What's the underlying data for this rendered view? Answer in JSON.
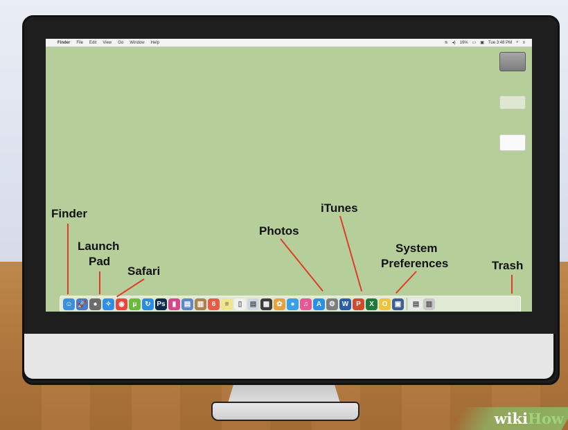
{
  "menubar": {
    "apple": "",
    "app": "Finder",
    "menus": [
      "File",
      "Edit",
      "View",
      "Go",
      "Window",
      "Help"
    ],
    "battery": "16%",
    "clock": "Tue 3:48 PM"
  },
  "callouts": {
    "finder": "Finder",
    "launchpad_line1": "Launch",
    "launchpad_line2": "Pad",
    "safari": "Safari",
    "photos": "Photos",
    "itunes": "iTunes",
    "sysprefs_line1": "System",
    "sysprefs_line2": "Preferences",
    "trash": "Trash"
  },
  "dock_icons": [
    {
      "name": "finder-icon",
      "color": "#3b8fe0",
      "glyph": "☺"
    },
    {
      "name": "launchpad-icon",
      "color": "#4a79c6",
      "glyph": "🚀"
    },
    {
      "name": "app-icon",
      "color": "#6c6c6c",
      "glyph": "●"
    },
    {
      "name": "safari-icon",
      "color": "#2f8fe8",
      "glyph": "✧"
    },
    {
      "name": "chrome-icon",
      "color": "#e9473b",
      "glyph": "◉"
    },
    {
      "name": "utorrent-icon",
      "color": "#6aba3b",
      "glyph": "μ"
    },
    {
      "name": "sync-icon",
      "color": "#2b8de0",
      "glyph": "↻"
    },
    {
      "name": "photoshop-icon",
      "color": "#0c2a4e",
      "glyph": "Ps"
    },
    {
      "name": "app-icon-pink",
      "color": "#d8458d",
      "glyph": "▮"
    },
    {
      "name": "preview-icon",
      "color": "#5e87c8",
      "glyph": "▤"
    },
    {
      "name": "contacts-icon",
      "color": "#a9824e",
      "glyph": "▥"
    },
    {
      "name": "calendar-icon",
      "color": "#ea5b46",
      "glyph": "6"
    },
    {
      "name": "notes-icon",
      "color": "#f1e58a",
      "glyph": "≡"
    },
    {
      "name": "textedit-icon",
      "color": "#f0f0f0",
      "glyph": "▯"
    },
    {
      "name": "document-icon",
      "color": "#cfd8e2",
      "glyph": "▤"
    },
    {
      "name": "app-icon-dark",
      "color": "#3d3d3d",
      "glyph": "▩"
    },
    {
      "name": "photos-icon",
      "color": "#e6a23c",
      "glyph": "✿"
    },
    {
      "name": "messages-icon",
      "color": "#36a0e8",
      "glyph": "●"
    },
    {
      "name": "itunes-icon",
      "color": "#e75795",
      "glyph": "♫"
    },
    {
      "name": "app-store-icon",
      "color": "#2a8fe6",
      "glyph": "A"
    },
    {
      "name": "system-preferences-icon",
      "color": "#7e7e7e",
      "glyph": "⚙"
    },
    {
      "name": "word-icon",
      "color": "#2b5ca8",
      "glyph": "W"
    },
    {
      "name": "powerpoint-icon",
      "color": "#d24a2c",
      "glyph": "P"
    },
    {
      "name": "excel-icon",
      "color": "#1d7a3c",
      "glyph": "X"
    },
    {
      "name": "outlook-icon",
      "color": "#f0c43a",
      "glyph": "O"
    },
    {
      "name": "virtualbox-icon",
      "color": "#3c5e93",
      "glyph": "▣"
    }
  ],
  "dock_right": [
    {
      "name": "downloads-icon",
      "color": "#e9e9e9",
      "glyph": "▤"
    },
    {
      "name": "trash-icon",
      "color": "#c8c8c8",
      "glyph": "▥"
    }
  ],
  "watermark": {
    "part1": "wiki",
    "part2": "How"
  }
}
